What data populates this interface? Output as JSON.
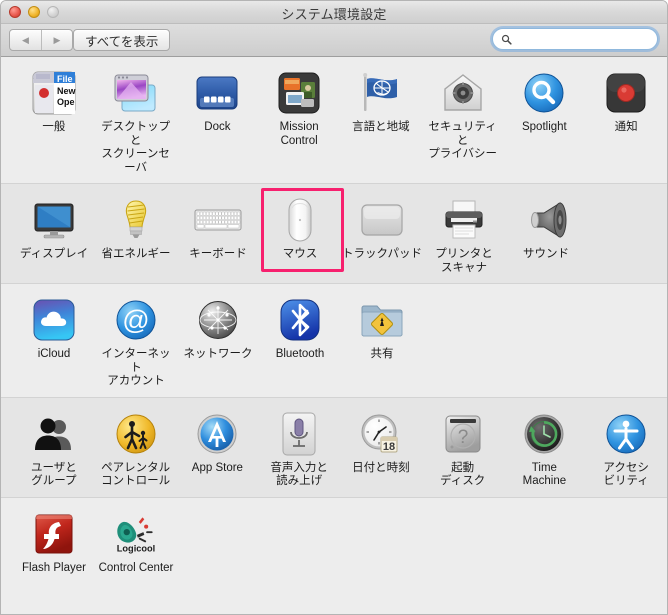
{
  "window": {
    "title": "システム環境設定",
    "traffic_lights": [
      "close-red",
      "minimize-yellow",
      "zoom-gray-disabled"
    ]
  },
  "toolbar": {
    "back_label": "◀",
    "forward_label": "▶",
    "show_all_label": "すべてを表示",
    "search_placeholder": "",
    "search_value": "",
    "search_icon": "magnifier-icon"
  },
  "rows": [
    {
      "band": "plain",
      "items": [
        {
          "label": "一般",
          "icon": "general-icon",
          "selected": false
        },
        {
          "label": "デスクトップと\nスクリーンセーバ",
          "icon": "desktop-screensaver-icon",
          "selected": false
        },
        {
          "label": "Dock",
          "icon": "dock-icon",
          "selected": false
        },
        {
          "label": "Mission\nControl",
          "icon": "mission-control-icon",
          "selected": false
        },
        {
          "label": "言語と地域",
          "icon": "language-region-icon",
          "selected": false
        },
        {
          "label": "セキュリティと\nプライバシー",
          "icon": "security-privacy-icon",
          "selected": false
        },
        {
          "label": "Spotlight",
          "icon": "spotlight-icon",
          "selected": false
        },
        {
          "label": "通知",
          "icon": "notifications-icon",
          "selected": false
        }
      ]
    },
    {
      "band": "alt",
      "items": [
        {
          "label": "ディスプレイ",
          "icon": "displays-icon",
          "selected": false
        },
        {
          "label": "省エネルギー",
          "icon": "energy-saver-icon",
          "selected": false
        },
        {
          "label": "キーボード",
          "icon": "keyboard-icon",
          "selected": false
        },
        {
          "label": "マウス",
          "icon": "mouse-icon",
          "selected": true
        },
        {
          "label": "トラックパッド",
          "icon": "trackpad-icon",
          "selected": false
        },
        {
          "label": "プリンタと\nスキャナ",
          "icon": "printers-scanners-icon",
          "selected": false
        },
        {
          "label": "サウンド",
          "icon": "sound-icon",
          "selected": false
        }
      ]
    },
    {
      "band": "plain",
      "items": [
        {
          "label": "iCloud",
          "icon": "icloud-icon",
          "selected": false
        },
        {
          "label": "インターネット\nアカウント",
          "icon": "internet-accounts-icon",
          "selected": false
        },
        {
          "label": "ネットワーク",
          "icon": "network-icon",
          "selected": false
        },
        {
          "label": "Bluetooth",
          "icon": "bluetooth-icon",
          "selected": false
        },
        {
          "label": "共有",
          "icon": "sharing-icon",
          "selected": false
        }
      ]
    },
    {
      "band": "alt",
      "items": [
        {
          "label": "ユーザと\nグループ",
          "icon": "users-groups-icon",
          "selected": false
        },
        {
          "label": "ペアレンタル\nコントロール",
          "icon": "parental-controls-icon",
          "selected": false
        },
        {
          "label": "App Store",
          "icon": "app-store-icon",
          "selected": false
        },
        {
          "label": "音声入力と\n読み上げ",
          "icon": "dictation-speech-icon",
          "selected": false
        },
        {
          "label": "日付と時刻",
          "icon": "date-time-icon",
          "selected": false
        },
        {
          "label": "起動\nディスク",
          "icon": "startup-disk-icon",
          "selected": false
        },
        {
          "label": "Time\nMachine",
          "icon": "time-machine-icon",
          "selected": false
        },
        {
          "label": "アクセシ\nビリティ",
          "icon": "accessibility-icon",
          "selected": false
        }
      ]
    },
    {
      "band": "plain",
      "items": [
        {
          "label": "Flash Player",
          "icon": "flash-player-icon",
          "selected": false
        },
        {
          "label": "Control Center",
          "icon": "logicool-control-center-icon",
          "selected": false
        }
      ]
    }
  ],
  "colors": {
    "selection_highlight": "#f7206e",
    "window_chrome": "#d8d8d8",
    "row_light": "#ededed",
    "row_dark": "#e5e5e5",
    "label_text": "#1c1c1c"
  }
}
